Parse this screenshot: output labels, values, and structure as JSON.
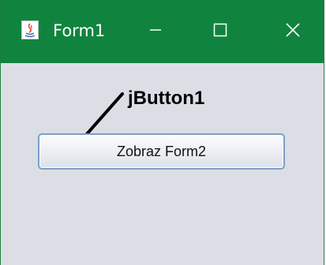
{
  "window": {
    "title": "Form1",
    "titlebar_color": "#10843e",
    "background_color": "#dcdee6",
    "controls": {
      "minimize_icon": "minimize-icon",
      "maximize_icon": "maximize-icon",
      "close_icon": "close-icon"
    }
  },
  "content": {
    "annotation_label": "jButton1",
    "button_label": "Zobraz Form2"
  }
}
